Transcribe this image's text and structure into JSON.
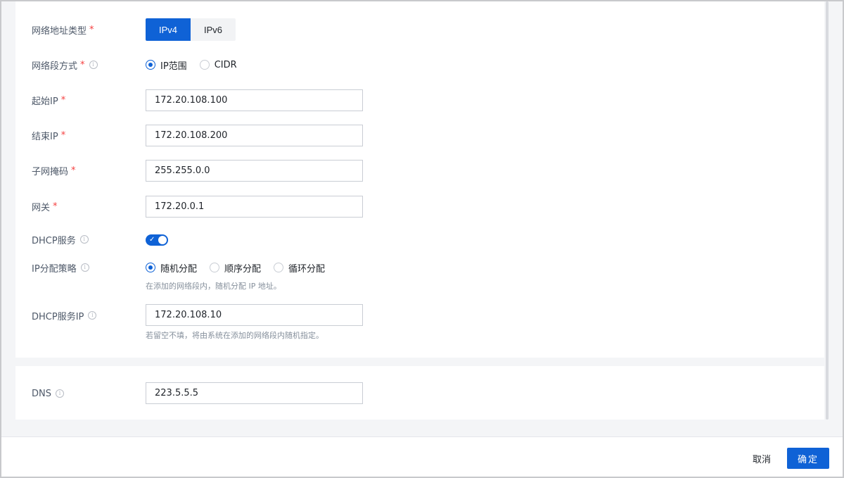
{
  "form": {
    "address_type": {
      "label": "网络地址类型",
      "required": "*",
      "options": [
        "IPv4",
        "IPv6"
      ],
      "selected": "IPv4"
    },
    "segment_mode": {
      "label": "网络段方式",
      "required": "*",
      "info_icon": "ⓘ",
      "options": [
        "IP范围",
        "CIDR"
      ],
      "selected": "IP范围"
    },
    "start_ip": {
      "label": "起始IP",
      "required": "*",
      "value": "172.20.108.100"
    },
    "end_ip": {
      "label": "结束IP",
      "required": "*",
      "value": "172.20.108.200"
    },
    "subnet_mask": {
      "label": "子网掩码",
      "required": "*",
      "value": "255.255.0.0"
    },
    "gateway": {
      "label": "网关",
      "required": "*",
      "value": "172.20.0.1"
    },
    "dhcp_service": {
      "label": "DHCP服务",
      "info_icon": "ⓘ",
      "enabled": true,
      "check": "✓"
    },
    "ip_strategy": {
      "label": "IP分配策略",
      "info_icon": "ⓘ",
      "options": [
        "随机分配",
        "顺序分配",
        "循环分配"
      ],
      "selected": "随机分配",
      "hint": "在添加的网络段内，随机分配 IP 地址。"
    },
    "dhcp_ip": {
      "label": "DHCP服务IP",
      "info_icon": "ⓘ",
      "value": "172.20.108.10",
      "hint": "若留空不填，将由系统在添加的网络段内随机指定。"
    },
    "dns": {
      "label": "DNS",
      "info_icon": "ⓘ",
      "value": "223.5.5.5"
    }
  },
  "footer": {
    "cancel_label": "取消",
    "ok_label": "确定"
  },
  "colors": {
    "primary": "#0f62d6",
    "required": "#f53f3f",
    "background": "#f4f5f7"
  }
}
